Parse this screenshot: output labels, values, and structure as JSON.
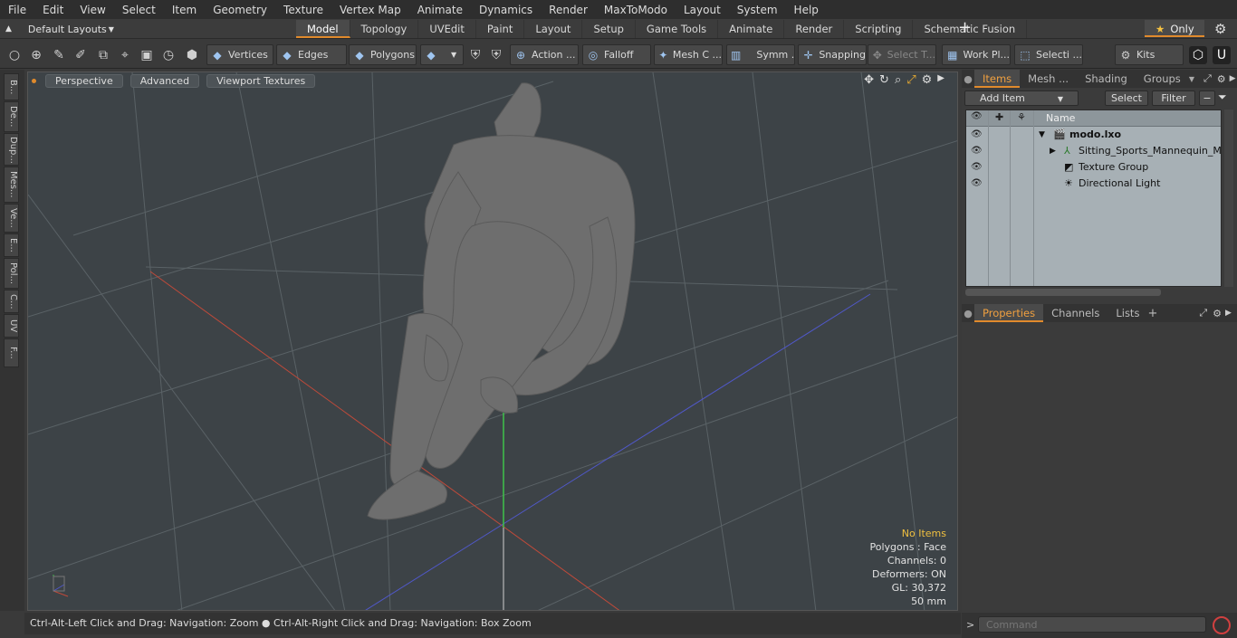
{
  "menu": [
    "File",
    "Edit",
    "View",
    "Select",
    "Item",
    "Geometry",
    "Texture",
    "Vertex Map",
    "Animate",
    "Dynamics",
    "Render",
    "MaxToModo",
    "Layout",
    "System",
    "Help"
  ],
  "layouts": "Default Layouts",
  "tabs": [
    "Model",
    "Topology",
    "UVEdit",
    "Paint",
    "Layout",
    "Setup",
    "Game Tools",
    "Animate",
    "Render",
    "Scripting",
    "Schematic Fusion"
  ],
  "active_tab": "Model",
  "only_label": "Only",
  "toolbar": {
    "vertices": "Vertices",
    "edges": "Edges",
    "polygons": "Polygons",
    "action": "Action ...",
    "falloff": "Falloff",
    "mesh": "Mesh C ...",
    "symm": "Symm ...",
    "snapping": "Snapping",
    "select_t": "Select T...",
    "work_pl": "Work Pl...",
    "selecti": "Selecti ...",
    "kits": "Kits"
  },
  "left_tabs": [
    "B...",
    "De...",
    "Dup...",
    "Mes...",
    "Ve...",
    "E...",
    "Pol...",
    "C...",
    "UV",
    "F..."
  ],
  "viewport": {
    "buttons": [
      "Perspective",
      "Advanced",
      "Viewport Textures"
    ],
    "stats": {
      "no_items": "No Items",
      "polygons": "Polygons : Face",
      "channels": "Channels: 0",
      "deformers": "Deformers: ON",
      "gl": "GL: 30,372",
      "focal": "50 mm"
    }
  },
  "status": {
    "left": "Ctrl-Alt-Left Click and Drag: Navigation: Zoom",
    "right": "Ctrl-Alt-Right Click and Drag: Navigation: Box Zoom"
  },
  "items_panel": {
    "tabs": [
      "Items",
      "Mesh ...",
      "Shading",
      "Groups"
    ],
    "add_item": "Add Item",
    "select": "Select",
    "filter": "Filter",
    "column_name": "Name",
    "rows": [
      {
        "name": "modo.lxo"
      },
      {
        "name": "Sitting_Sports_Mannequin_M ..."
      },
      {
        "name": "Texture Group"
      },
      {
        "name": "Directional Light"
      }
    ]
  },
  "properties_panel": {
    "tabs": [
      "Properties",
      "Channels",
      "Lists"
    ]
  },
  "command_placeholder": "Command"
}
